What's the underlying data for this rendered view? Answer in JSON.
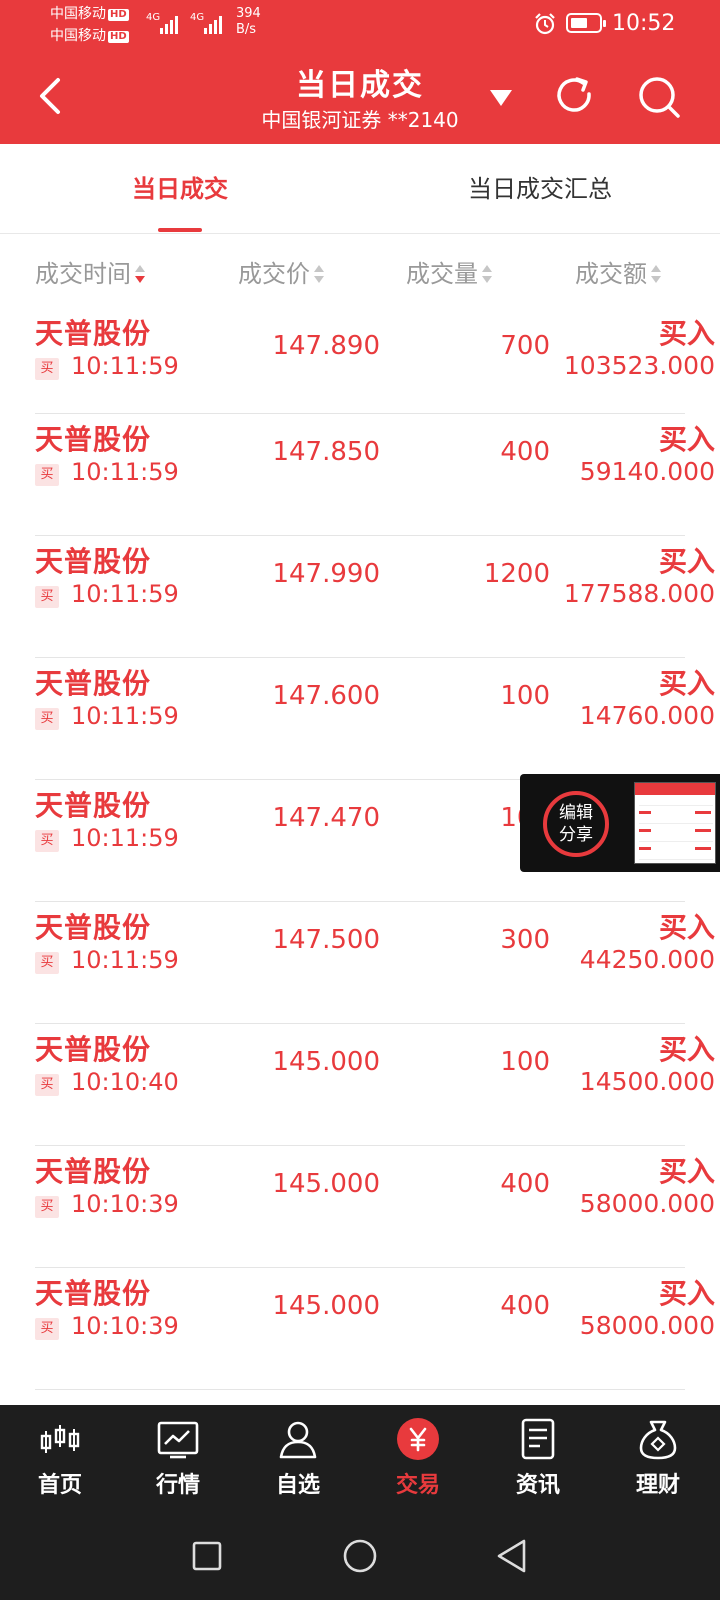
{
  "status_bar": {
    "carrier_1": "中国移动",
    "carrier_2": "中国移动",
    "hd_badge": "HD",
    "network_type": "4G",
    "speed_value": "394",
    "speed_unit": "B/s",
    "time": "10:52"
  },
  "header": {
    "title": "当日成交",
    "subtitle": "中国银河证券 **2140",
    "icons": [
      "back-icon",
      "dropdown-triangle-icon",
      "refresh-icon",
      "search-icon"
    ]
  },
  "tabs": [
    {
      "label": "当日成交",
      "active": true
    },
    {
      "label": "当日成交汇总",
      "active": false
    }
  ],
  "columns": [
    {
      "label": "成交时间",
      "sort": "desc"
    },
    {
      "label": "成交价",
      "sort": "none"
    },
    {
      "label": "成交量",
      "sort": "none"
    },
    {
      "label": "成交额",
      "sort": "none"
    }
  ],
  "trades": [
    {
      "name": "天普股份",
      "side_tag": "买",
      "time": "10:11:59",
      "price": "147.890",
      "qty": "700",
      "action": "买入",
      "amount": "103523.000"
    },
    {
      "name": "天普股份",
      "side_tag": "买",
      "time": "10:11:59",
      "price": "147.850",
      "qty": "400",
      "action": "买入",
      "amount": "59140.000"
    },
    {
      "name": "天普股份",
      "side_tag": "买",
      "time": "10:11:59",
      "price": "147.990",
      "qty": "1200",
      "action": "买入",
      "amount": "177588.000"
    },
    {
      "name": "天普股份",
      "side_tag": "买",
      "time": "10:11:59",
      "price": "147.600",
      "qty": "100",
      "action": "买入",
      "amount": "14760.000"
    },
    {
      "name": "天普股份",
      "side_tag": "买",
      "time": "10:11:59",
      "price": "147.470",
      "qty": "100",
      "action": "",
      "amount": ""
    },
    {
      "name": "天普股份",
      "side_tag": "买",
      "time": "10:11:59",
      "price": "147.500",
      "qty": "300",
      "action": "买入",
      "amount": "44250.000"
    },
    {
      "name": "天普股份",
      "side_tag": "买",
      "time": "10:10:40",
      "price": "145.000",
      "qty": "100",
      "action": "买入",
      "amount": "14500.000"
    },
    {
      "name": "天普股份",
      "side_tag": "买",
      "time": "10:10:39",
      "price": "145.000",
      "qty": "400",
      "action": "买入",
      "amount": "58000.000"
    },
    {
      "name": "天普股份",
      "side_tag": "买",
      "time": "10:10:39",
      "price": "145.000",
      "qty": "400",
      "action": "买入",
      "amount": "58000.000"
    }
  ],
  "share_popup": {
    "line1": "编辑",
    "line2": "分享"
  },
  "bottom_nav": [
    {
      "label": "首页",
      "icon": "candlestick-icon",
      "active": false
    },
    {
      "label": "行情",
      "icon": "chart-icon",
      "active": false
    },
    {
      "label": "自选",
      "icon": "user-icon",
      "active": false
    },
    {
      "label": "交易",
      "icon": "yen-icon",
      "active": true
    },
    {
      "label": "资讯",
      "icon": "document-icon",
      "active": false
    },
    {
      "label": "理财",
      "icon": "money-bag-icon",
      "active": false
    }
  ],
  "system_nav": [
    "recents-icon",
    "home-icon",
    "back-triangle-icon"
  ],
  "colors": {
    "accent": "#e83a3d",
    "header_bg": "#e83a3d",
    "nav_bg": "#1e1e1e",
    "muted_text": "#999999"
  }
}
